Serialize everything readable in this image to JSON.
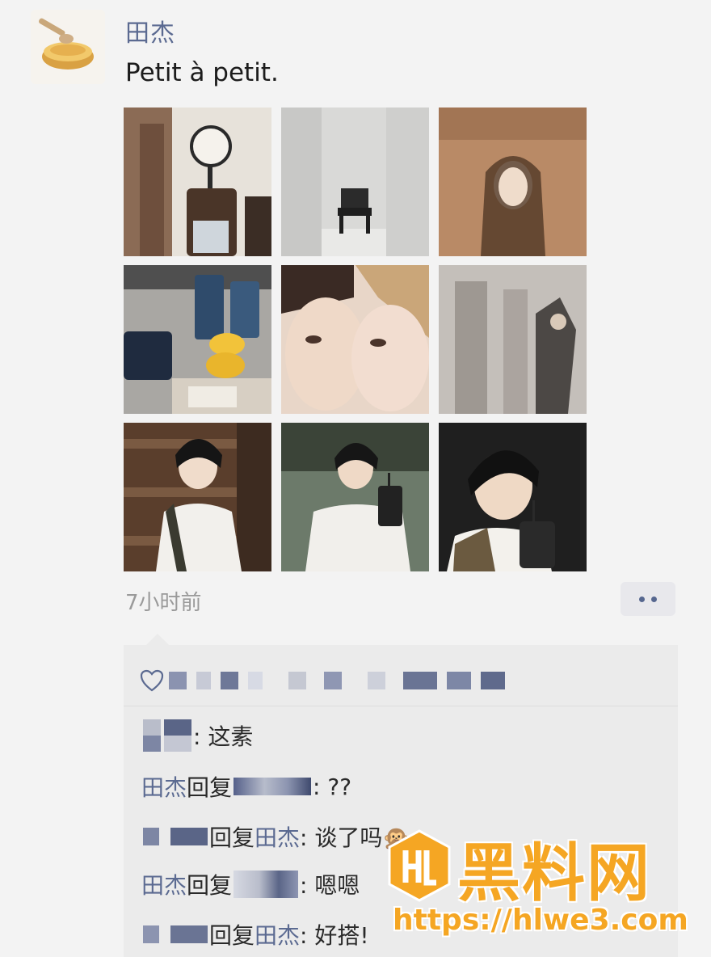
{
  "post": {
    "author": "田杰",
    "text": "Petit à petit.",
    "timestamp": "7小时前",
    "photo_count": 9
  },
  "actions": {
    "more_icon": "more-dots-icon"
  },
  "likes": {
    "icon": "heart-icon"
  },
  "comments": [
    {
      "from": "",
      "text": ": 这素"
    },
    {
      "from": "田杰",
      "reply_word": "回复",
      "text": ": ??"
    },
    {
      "reply_word": "回复",
      "to": "田杰",
      "text": ": 谈了吗🙊"
    },
    {
      "from": "田杰",
      "reply_word": "回复",
      "text": ": 嗯嗯"
    },
    {
      "reply_word": "回复",
      "to": "田杰",
      "text": ": 好搭!"
    }
  ],
  "watermark": {
    "title": "黑料网",
    "url": "https://hlwe3.com",
    "color": "#f5a623"
  },
  "colors": {
    "name_blue": "#5b6a91",
    "background": "#f3f3f3",
    "comment_bg": "#ebebeb"
  }
}
